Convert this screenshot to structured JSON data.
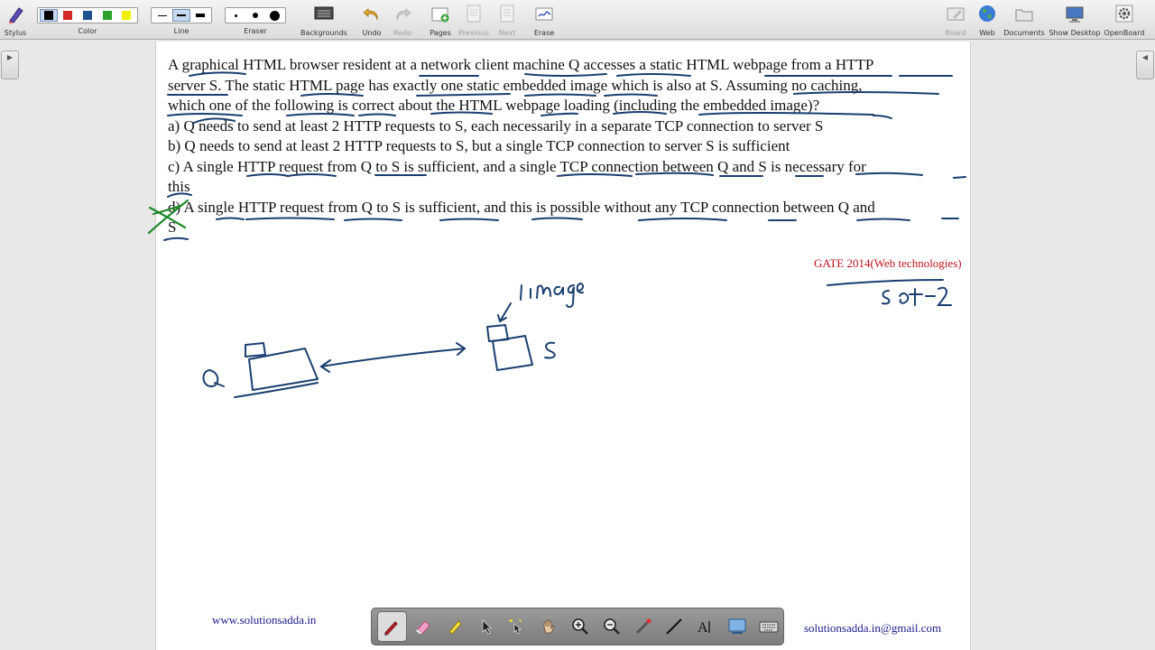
{
  "toolbar": {
    "stylus_label": "Stylus",
    "color_label": "Color",
    "line_label": "Line",
    "eraser_label": "Eraser",
    "backgrounds_label": "Backgrounds",
    "undo_label": "Undo",
    "redo_label": "Redo",
    "pages_label": "Pages",
    "previous_label": "Previous",
    "next_label": "Next",
    "erase_label": "Erase",
    "board_label": "Board",
    "web_label": "Web",
    "documents_label": "Documents",
    "show_desktop_label": "Show Desktop",
    "openboard_label": "OpenBoard",
    "colors": [
      "#000000",
      "#d62728",
      "#1f4e8c",
      "#2ca02c",
      "#f2f200"
    ],
    "selected_color_index": 0
  },
  "question": {
    "stem_line1": "A graphical HTML browser resident at a network client machine Q accesses a static HTML webpage from a HTTP",
    "stem_line2": "server S. The static HTML page has exactly one static embedded image which is also at S. Assuming no caching,",
    "stem_line3": "which one of the following is correct about the HTML webpage loading (including the embedded image)?",
    "option_a": "a) Q needs to send at least 2 HTTP requests to S, each necessarily in a separate TCP connection to server S",
    "option_b": "b) Q needs to send at least 2 HTTP requests to S, but a single TCP connection to server S is sufficient",
    "option_c_line1": "c) A single HTTP request from Q to S is sufficient, and a single TCP connection between Q and S is necessary for",
    "option_c_line2": "this",
    "option_d_line1": "d) A single HTTP request from Q to S is sufficient, and this is possible without any TCP connection between Q and",
    "option_d_line2": "S"
  },
  "annotations": {
    "gate_tag": "GATE 2014(Web technologies)",
    "set_label": "set-2",
    "image_label": "1 image",
    "client_label": "Q",
    "server_label": "S"
  },
  "footer": {
    "website": "www.solutionsadda.in",
    "email": "solutionsadda.in@gmail.com"
  },
  "dock_tools": [
    "pen-tool",
    "eraser-tool",
    "marker-tool",
    "selector-tool",
    "interact-tool",
    "hand-tool",
    "zoom-in-tool",
    "zoom-out-tool",
    "laser-pointer-tool",
    "line-tool",
    "text-tool",
    "capture-tool",
    "keyboard-tool"
  ],
  "dock_selected": "pen-tool"
}
